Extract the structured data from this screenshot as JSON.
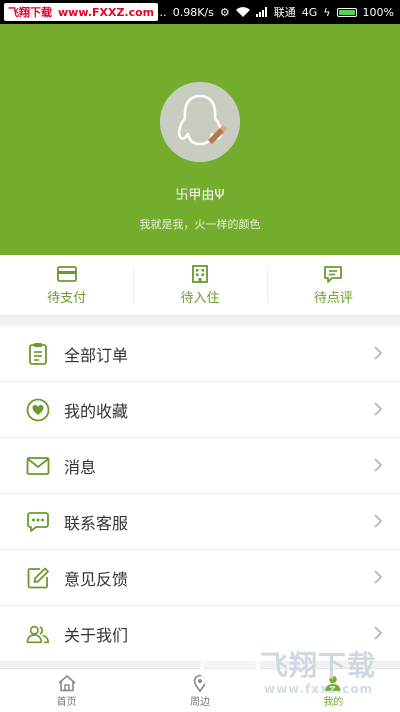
{
  "status_bar": {
    "left_brand": "飞翔下载",
    "left_url": "www.FXXZ.com",
    "speed": "0.98K/s",
    "carrier": "联通",
    "network": "4G",
    "battery_text": "100%",
    "battery_level": 1.0
  },
  "profile": {
    "nickname": "卐甲由Ψ",
    "signature": "我就是我，火一样的颜色",
    "avatar_icon": "qq-penguin-avatar-icon",
    "header_color": "#74ad2e"
  },
  "order_status": [
    {
      "label": "待支付",
      "icon": "card-icon"
    },
    {
      "label": "待入住",
      "icon": "building-icon"
    },
    {
      "label": "待点评",
      "icon": "comment-icon"
    }
  ],
  "menu": [
    {
      "label": "全部订单",
      "icon": "clipboard-icon"
    },
    {
      "label": "我的收藏",
      "icon": "heart-icon"
    },
    {
      "label": "消息",
      "icon": "mail-icon"
    },
    {
      "label": "联系客服",
      "icon": "chat-icon"
    },
    {
      "label": "意见反馈",
      "icon": "edit-icon"
    },
    {
      "label": "关于我们",
      "icon": "users-icon"
    }
  ],
  "tabs": [
    {
      "label": "首页",
      "icon": "home-icon",
      "active": false
    },
    {
      "label": "周边",
      "icon": "location-icon",
      "active": false
    },
    {
      "label": "我的",
      "icon": "person-icon",
      "active": true
    }
  ],
  "watermark": {
    "title": "飞翔下载",
    "url": "www.fxxz.com"
  },
  "colors": {
    "accent": "#74ad2e",
    "icon_green": "#6a9b2a"
  }
}
